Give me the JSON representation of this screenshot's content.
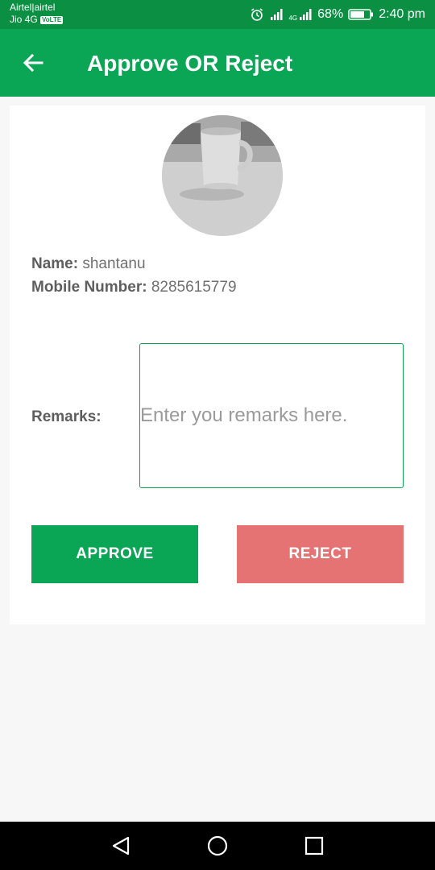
{
  "status_bar": {
    "carrier_1": "Airtel|airtel",
    "carrier_2": "Jio 4G",
    "volte_badge": "VoLTE",
    "network_tag": "4G",
    "battery_percent": "68%",
    "time": "2:40 pm"
  },
  "app_bar": {
    "title": "Approve OR Reject",
    "back_icon": "arrow-back-icon"
  },
  "profile": {
    "photo_icon": "mug-photo",
    "name_label": "Name:",
    "name_value": "shantanu",
    "mobile_label": "Mobile Number:",
    "mobile_value": "8285615779"
  },
  "remarks": {
    "label": "Remarks:",
    "value": "",
    "placeholder": "Enter you remarks here."
  },
  "actions": {
    "approve_label": "APPROVE",
    "reject_label": "REJECT"
  },
  "colors": {
    "primary": "#0aa555",
    "status_bar": "#0b8f43",
    "reject": "#e57373",
    "background": "#f7f7f7"
  },
  "nav_bar": {
    "back_icon": "triangle-back-icon",
    "home_icon": "circle-home-icon",
    "recents_icon": "square-recents-icon"
  }
}
